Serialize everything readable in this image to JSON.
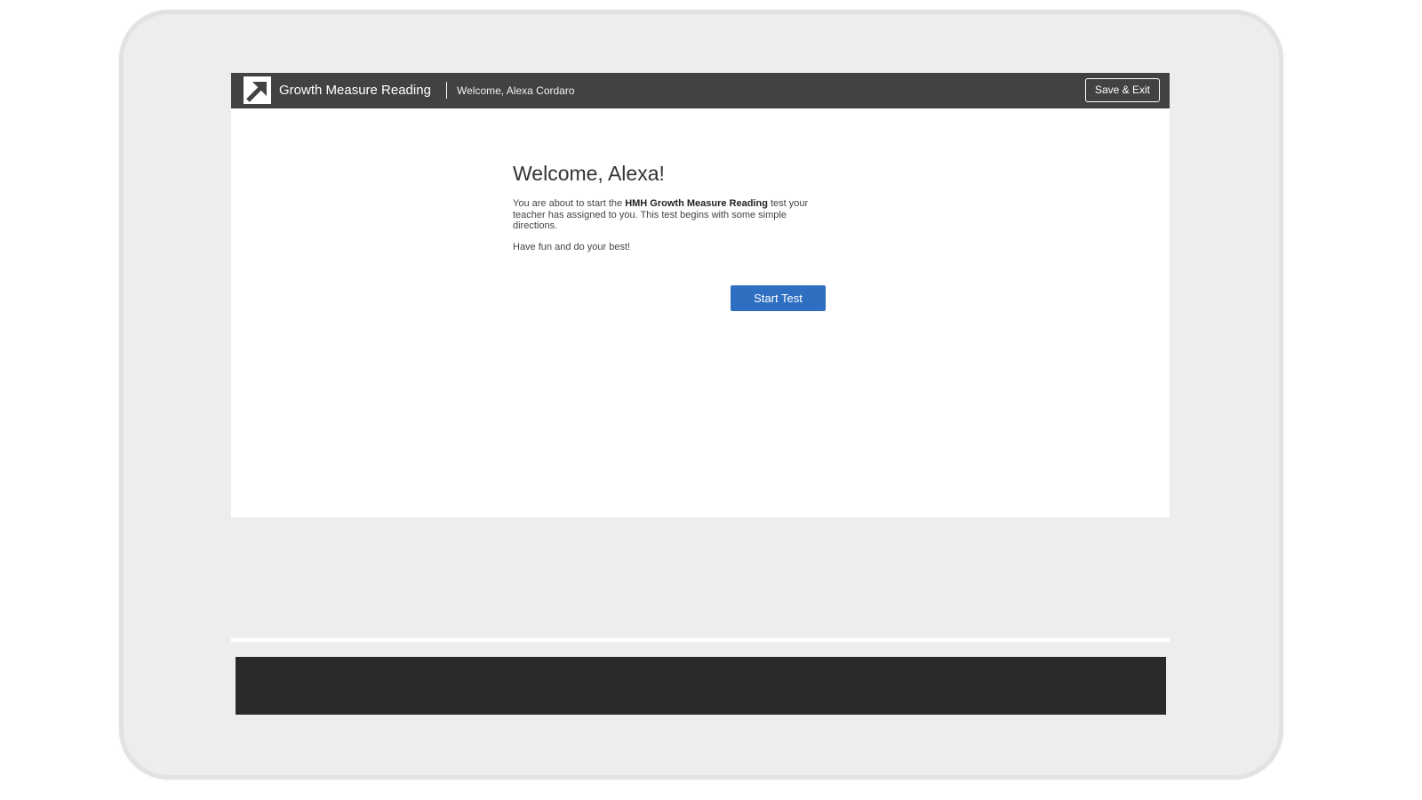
{
  "header": {
    "logo_icon": "growth-arrow-icon",
    "app_title": "Growth Measure Reading",
    "welcome_user": "Welcome, Alexa Cordaro",
    "save_exit_label": "Save & Exit"
  },
  "main": {
    "heading": "Welcome, Alexa!",
    "intro_prefix": "You are about to start the ",
    "intro_bold": "HMH Growth Measure Reading",
    "intro_suffix": " test your teacher has assigned to you. This test begins with some simple directions.",
    "encouragement": "Have fun and do your best!",
    "start_button_label": "Start Test"
  },
  "colors": {
    "header_bg": "#424242",
    "primary_button": "#2f6fc2",
    "device_frame": "#ededed",
    "footer_bar": "#2a2a2a"
  }
}
